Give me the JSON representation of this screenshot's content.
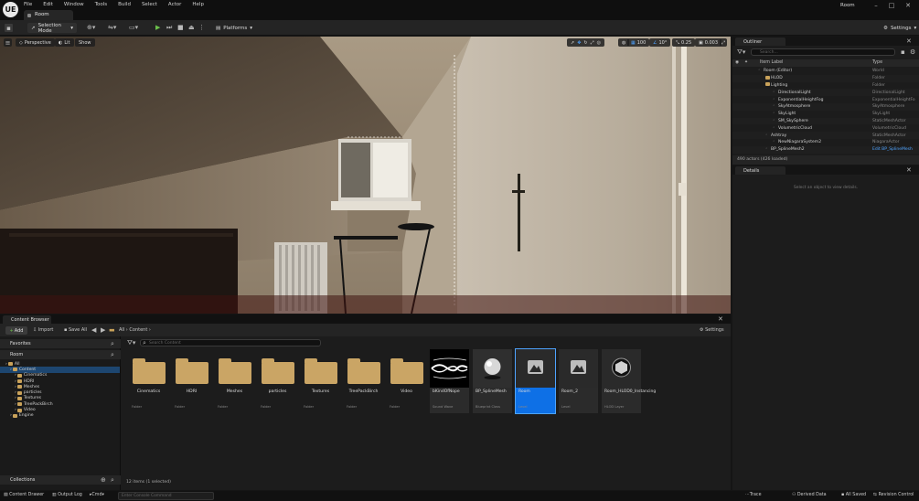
{
  "app": {
    "logo": "UE",
    "tab": "Room",
    "window_title": "Room"
  },
  "menu": [
    "File",
    "Edit",
    "Window",
    "Tools",
    "Build",
    "Select",
    "Actor",
    "Help"
  ],
  "toolbar": {
    "selection_mode": "Selection Mode",
    "platforms": "Platforms",
    "settings": "Settings"
  },
  "viewport": {
    "perspective": "Perspective",
    "lit": "Lit",
    "show": "Show",
    "grid_snap": "100",
    "rot_snap": "10°",
    "scale_snap": "0.25",
    "cam_speed": "0.003"
  },
  "content_browser": {
    "tab": "Content Browser",
    "add": "Add",
    "import": "Import",
    "save_all": "Save All",
    "path": [
      "All",
      "Content"
    ],
    "settings": "Settings",
    "favorites": "Favorites",
    "root": "Room",
    "search_placeholder": "Search Content",
    "collections": "Collections",
    "status": "12 items (1 selected)",
    "tree": [
      {
        "label": "All",
        "depth": 0,
        "selected": false
      },
      {
        "label": "Content",
        "depth": 1,
        "selected": true
      },
      {
        "label": "Cinematics",
        "depth": 2,
        "selected": false
      },
      {
        "label": "HDRI",
        "depth": 2,
        "selected": false
      },
      {
        "label": "Meshes",
        "depth": 2,
        "selected": false
      },
      {
        "label": "particles",
        "depth": 2,
        "selected": false
      },
      {
        "label": "Textures",
        "depth": 2,
        "selected": false
      },
      {
        "label": "TreePackBirch",
        "depth": 2,
        "selected": false
      },
      {
        "label": "Video",
        "depth": 2,
        "selected": false
      },
      {
        "label": "Engine",
        "depth": 1,
        "selected": false
      }
    ],
    "folders": [
      {
        "label": "Cinematics",
        "type": "Folder"
      },
      {
        "label": "HDRI",
        "type": "Folder"
      },
      {
        "label": "Meshes",
        "type": "Folder"
      },
      {
        "label": "particles",
        "type": "Folder"
      },
      {
        "label": "Textures",
        "type": "Folder"
      },
      {
        "label": "TreePackBirch",
        "type": "Folder"
      },
      {
        "label": "Video",
        "type": "Folder"
      }
    ],
    "assets": [
      {
        "label": "bKindOfNope",
        "type": "Sound Wave",
        "kind": "wave"
      },
      {
        "label": "BP_SplineMesh",
        "type": "Blueprint Class",
        "kind": "sphere"
      },
      {
        "label": "Room",
        "type": "Level",
        "kind": "level",
        "selected": true
      },
      {
        "label": "Room_2",
        "type": "Level",
        "kind": "level"
      },
      {
        "label": "Room_HLOD0_Instancing",
        "type": "HLOD Layer",
        "kind": "hlod"
      }
    ]
  },
  "outliner": {
    "tab": "Outliner",
    "search_placeholder": "Search...",
    "col_label": "Item Label",
    "col_type": "Type",
    "rows": [
      {
        "label": "Room (Editor)",
        "type": "World",
        "depth": 0
      },
      {
        "label": "HLOD",
        "type": "Folder",
        "depth": 1
      },
      {
        "label": "Lighting",
        "type": "Folder",
        "depth": 1
      },
      {
        "label": "DirectionalLight",
        "type": "DirectionalLight",
        "depth": 2
      },
      {
        "label": "ExponentialHeightFog",
        "type": "ExponentialHeightFo",
        "depth": 2
      },
      {
        "label": "SkyAtmosphere",
        "type": "SkyAtmosphere",
        "depth": 2
      },
      {
        "label": "SkyLight",
        "type": "SkyLight",
        "depth": 2
      },
      {
        "label": "SM_SkySphere",
        "type": "StaticMeshActor",
        "depth": 2
      },
      {
        "label": "VolumetricCloud",
        "type": "VolumetricCloud",
        "depth": 2
      },
      {
        "label": "Ashtray",
        "type": "StaticMeshActor",
        "depth": 1
      },
      {
        "label": "NewNiagaraSystem2",
        "type": "NiagaraActor",
        "depth": 2
      },
      {
        "label": "BP_SplineMesh2",
        "type": "Edit BP_SplineMesh",
        "depth": 1
      }
    ],
    "status": "490 actors (426 loaded)"
  },
  "details": {
    "tab": "Details",
    "empty": "Select an object to view details."
  },
  "bottom": {
    "content_drawer": "Content Drawer",
    "output_log": "Output Log",
    "cmd": "Cmd",
    "console_placeholder": "Enter Console Command",
    "trace": "Trace",
    "derived_data": "Derived Data",
    "all_saved": "All Saved",
    "revision_control": "Revision Control"
  },
  "colors": {
    "accent": "#0e70e6",
    "folder": "#caa565",
    "play": "#6bc04b"
  }
}
